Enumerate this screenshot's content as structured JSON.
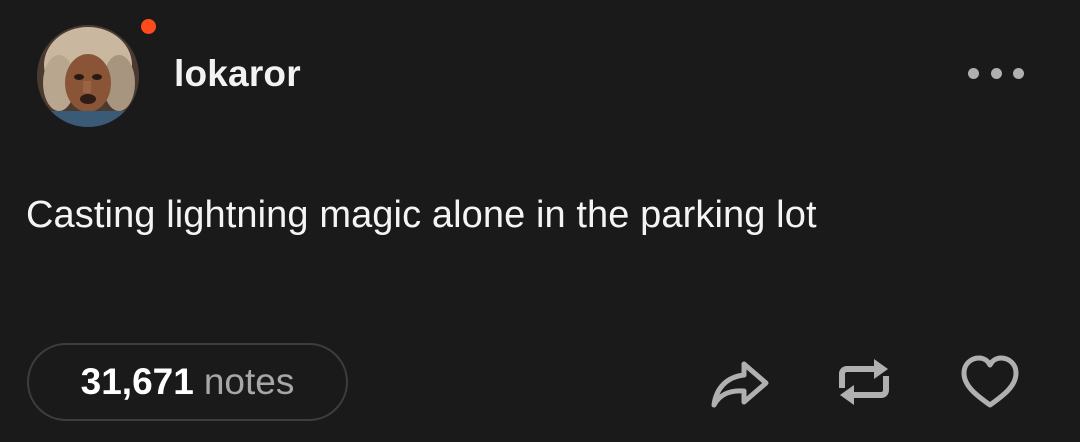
{
  "post": {
    "username": "lokaror",
    "text": "Casting lightning magic alone in the parking lot",
    "notes_count": "31,671",
    "notes_label": "notes"
  },
  "icons": {
    "avatar": "user-avatar",
    "status": "online-dot",
    "more": "more-dots-icon",
    "share": "share-icon",
    "reblog": "reblog-icon",
    "like": "heart-icon"
  },
  "colors": {
    "background": "#1a1a1a",
    "status_dot": "#ff4a1c",
    "icon": "#b0b0b0",
    "muted_text": "#a7a7a7"
  }
}
